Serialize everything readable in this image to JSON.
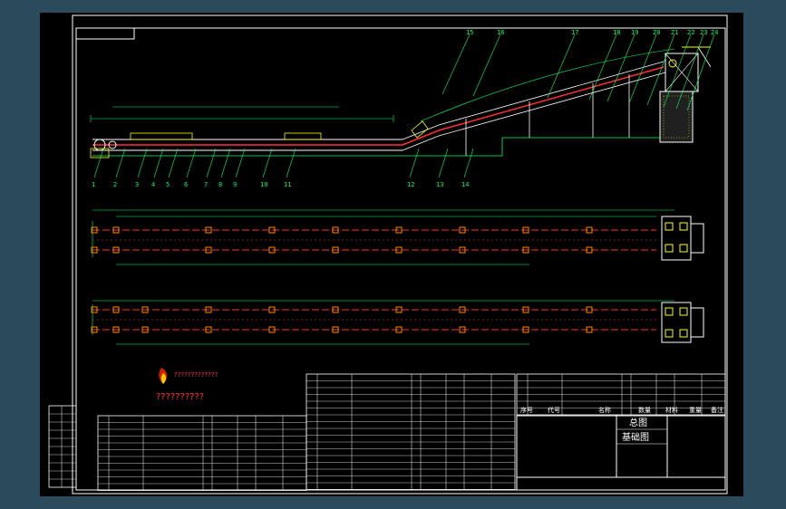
{
  "title_block": {
    "drawing_name": "基础图",
    "drawing_type": "总图",
    "logo_caption": "??????????",
    "logo_sub": "?????????????"
  },
  "callouts": [
    "1",
    "2",
    "3",
    "4",
    "5",
    "6",
    "7",
    "8",
    "9",
    "10",
    "11",
    "12",
    "13",
    "14",
    "15",
    "16",
    "17",
    "18",
    "19",
    "20",
    "21",
    "22",
    "23",
    "24"
  ],
  "table_headers": [
    "序号",
    "代号",
    "名称",
    "数量",
    "材料",
    "重量",
    "备注"
  ],
  "colors": {
    "background": "#000000",
    "frame": "#ffffff",
    "conveyor": "#ff3030",
    "dimension": "#00ff66",
    "structure": "#ffffff",
    "hatch": "#ffff00",
    "accent": "#ff8800"
  }
}
